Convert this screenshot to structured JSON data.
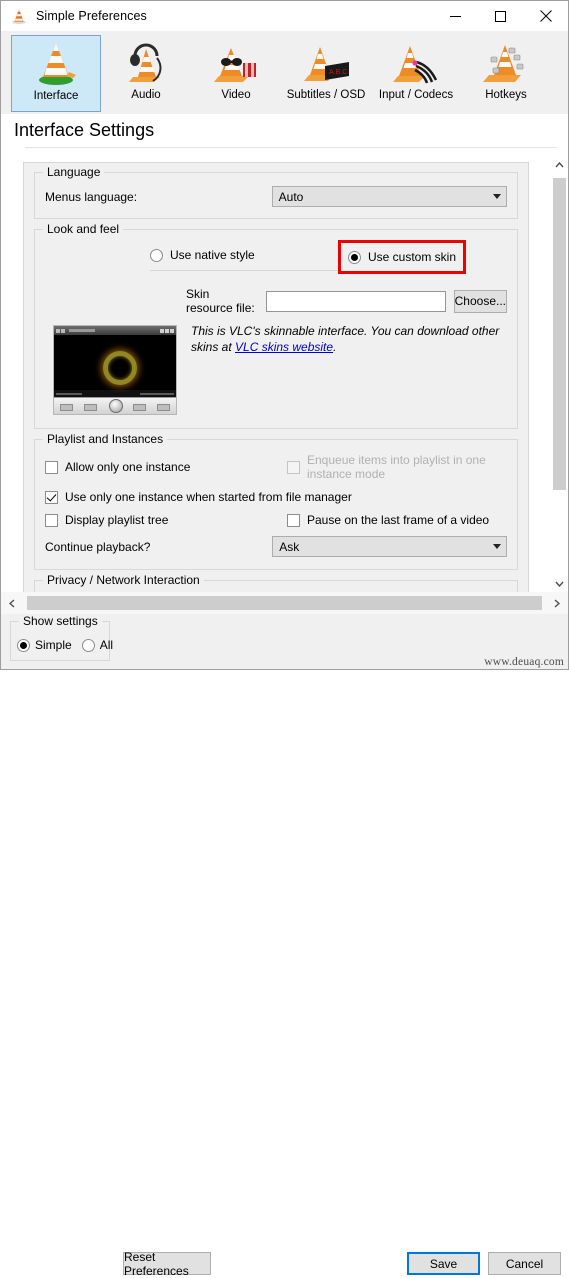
{
  "window": {
    "title": "Simple Preferences",
    "icon": "vlc-cone-icon",
    "controls": {
      "minimize": "—",
      "maximize": "□",
      "close": "✕"
    }
  },
  "toolbar": {
    "items": [
      {
        "label": "Interface",
        "icon": "vlc-cone-icon",
        "selected": true
      },
      {
        "label": "Audio",
        "icon": "vlc-headphones-icon",
        "selected": false
      },
      {
        "label": "Video",
        "icon": "vlc-video-glasses-icon",
        "selected": false
      },
      {
        "label": "Subtitles / OSD",
        "icon": "vlc-subtitles-icon",
        "selected": false
      },
      {
        "label": "Input / Codecs",
        "icon": "vlc-cables-icon",
        "selected": false
      },
      {
        "label": "Hotkeys",
        "icon": "vlc-keyboard-icon",
        "selected": false
      }
    ]
  },
  "page": {
    "title": "Interface Settings"
  },
  "language_group": {
    "title": "Language",
    "menus_language_label": "Menus language:",
    "menus_language_value": "Auto"
  },
  "look_and_feel": {
    "title": "Look and feel",
    "native_label": "Use native style",
    "native_checked": false,
    "custom_label": "Use custom skin",
    "custom_checked": true,
    "highlight_color": "#ee0000",
    "skin_file_label": "Skin resource file:",
    "skin_file_value": "",
    "choose_label": "Choose...",
    "info_text_before": "This is VLC's skinnable interface. You can download other skins at ",
    "info_link_text": "VLC skins website",
    "info_text_after": "."
  },
  "playlist_group": {
    "title": "Playlist and Instances",
    "allow_one_instance": {
      "label": "Allow only one instance",
      "checked": false,
      "disabled": false
    },
    "enqueue_items": {
      "label": "Enqueue items into playlist in one instance mode",
      "checked": false,
      "disabled": true
    },
    "use_one_instance_file_manager": {
      "label": "Use only one instance when started from file manager",
      "checked": true,
      "disabled": false
    },
    "display_playlist_tree": {
      "label": "Display playlist tree",
      "checked": false,
      "disabled": false
    },
    "pause_last_frame": {
      "label": "Pause on the last frame of a video",
      "checked": false,
      "disabled": false
    },
    "continue_playback_label": "Continue playback?",
    "continue_playback_value": "Ask"
  },
  "privacy_group": {
    "title": "Privacy / Network Interaction"
  },
  "footer": {
    "show_settings_title": "Show settings",
    "simple_label": "Simple",
    "simple_checked": true,
    "all_label": "All",
    "all_checked": false,
    "reset_label": "Reset Preferences",
    "save_label": "Save",
    "cancel_label": "Cancel",
    "watermark": "www.deuaq.com"
  }
}
